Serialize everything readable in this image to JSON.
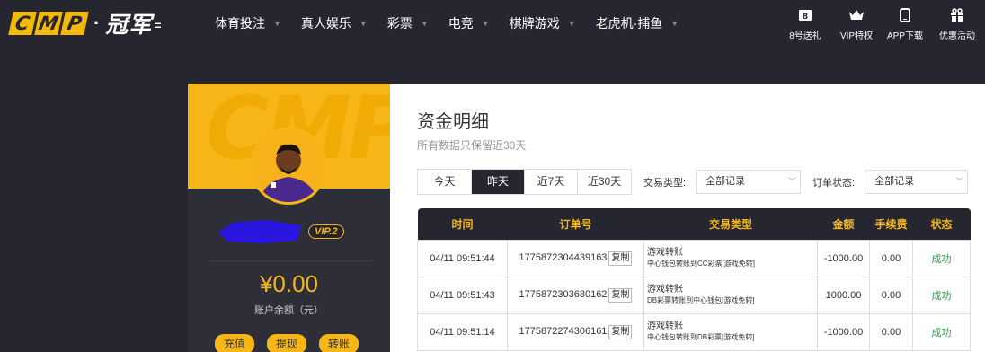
{
  "brand": {
    "letters": [
      "C",
      "M",
      "P"
    ],
    "separator": "·",
    "name": "冠军",
    "tail": "="
  },
  "menu": [
    {
      "label": "体育投注"
    },
    {
      "label": "真人娱乐"
    },
    {
      "label": "彩票"
    },
    {
      "label": "电竞"
    },
    {
      "label": "棋牌游戏"
    },
    {
      "label": "老虎机·捕鱼"
    }
  ],
  "quick_links": [
    {
      "label": "8号送礼",
      "icon": "gift-box-icon"
    },
    {
      "label": "VIP特权",
      "icon": "crown-icon"
    },
    {
      "label": "APP下载",
      "icon": "phone-icon"
    },
    {
      "label": "优惠活动",
      "icon": "present-icon"
    }
  ],
  "profile": {
    "banner_watermark": "CMP",
    "vip_badge": "VIP.2",
    "balance": "¥0.00",
    "balance_label": "账户余额（元）",
    "actions": [
      {
        "label": "充值"
      },
      {
        "label": "提现"
      },
      {
        "label": "转账"
      }
    ]
  },
  "page": {
    "title": "资金明细",
    "subtitle": "所有数据只保留近30天"
  },
  "filters": {
    "ranges": [
      {
        "label": "今天",
        "active": false
      },
      {
        "label": "昨天",
        "active": true
      },
      {
        "label": "近7天",
        "active": false
      },
      {
        "label": "近30天",
        "active": false
      }
    ],
    "type_label": "交易类型:",
    "type_value": "全部记录",
    "status_label": "订单状态:",
    "status_value": "全部记录"
  },
  "table": {
    "columns": [
      "时间",
      "订单号",
      "交易类型",
      "金额",
      "手续费",
      "状态"
    ],
    "copy_label": "复制",
    "rows": [
      {
        "time": "04/11 09:51:44",
        "order": "1775872304439163",
        "type": "游戏转账",
        "detail": "中心钱包转账到CC彩票[游戏免转]",
        "amount": "-1000.00",
        "fee": "0.00",
        "status": "成功"
      },
      {
        "time": "04/11 09:51:43",
        "order": "1775872303680162",
        "type": "游戏转账",
        "detail": "DB彩票转账到中心钱包[游戏免转]",
        "amount": "1000.00",
        "fee": "0.00",
        "status": "成功"
      },
      {
        "time": "04/11 09:51:14",
        "order": "1775872274306161",
        "type": "游戏转账",
        "detail": "中心钱包转账到DB彩票[游戏免转]",
        "amount": "-1000.00",
        "fee": "0.00",
        "status": "成功"
      }
    ]
  },
  "colors": {
    "accent": "#f6b617",
    "dark_bg": "#262630",
    "success": "#2f9a45"
  }
}
